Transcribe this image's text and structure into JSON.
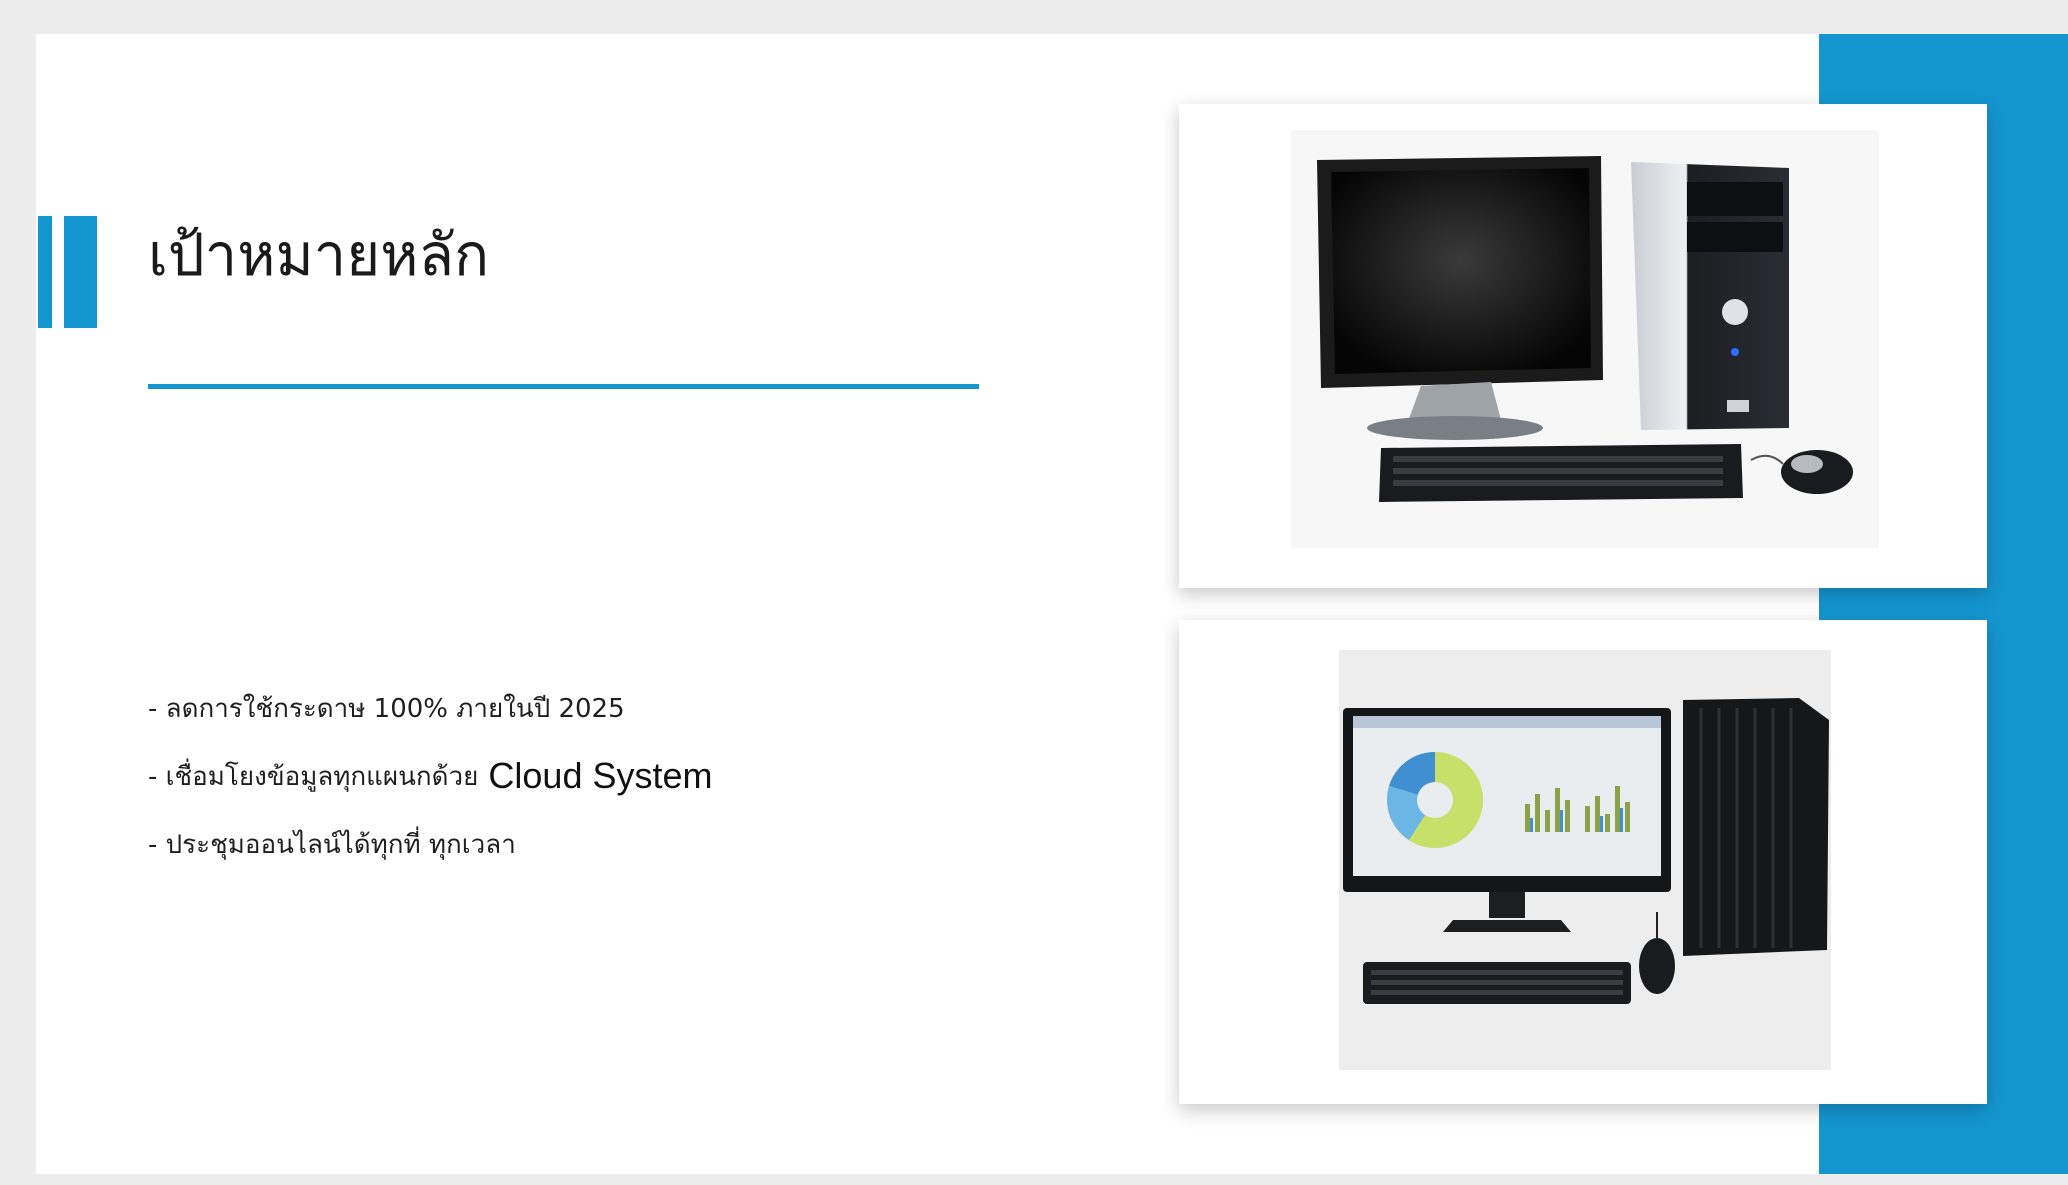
{
  "colors": {
    "accent": "#1496d0",
    "background": "#ececec",
    "slide": "#ffffff",
    "text": "#1f1f1f"
  },
  "slide": {
    "title": "เป้าหมายหลัก",
    "bullets": [
      {
        "text": "- ลดการใช้กระดาษ 100% ภายในปี 2025",
        "extra": ""
      },
      {
        "text": "- เชื่อมโยงข้อมูลทุกแผนกด้วย",
        "extra": "Cloud System"
      },
      {
        "text": "- ประชุมออนไลน์ได้ทุกที่ ทุกเวลา",
        "extra": ""
      }
    ],
    "images": [
      {
        "icon": "desktop-computer-tower-photo"
      },
      {
        "icon": "modern-desktop-pc-photo"
      }
    ]
  }
}
